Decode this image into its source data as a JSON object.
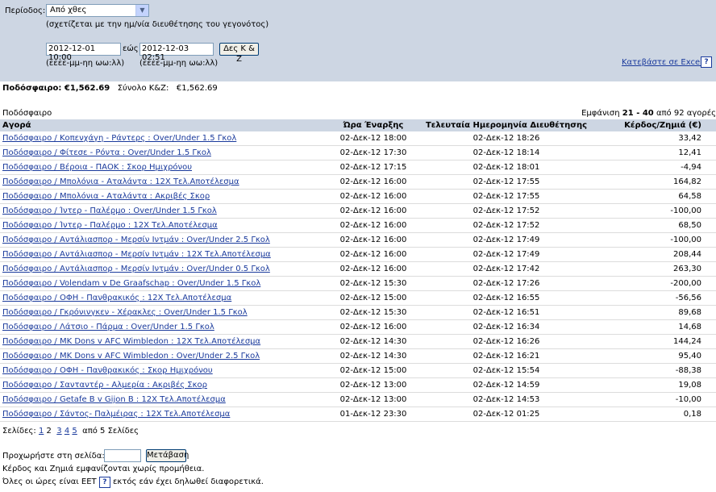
{
  "filter": {
    "period_label": "Περίοδος:",
    "period_value": "Από χθες",
    "period_note": "(σχετίζεται με την ημ/νία διευθέτησης του γεγονότος)",
    "date_from": "2012-12-01 10:00",
    "to_label": "εώς",
    "date_to": "2012-12-03 02:51",
    "show_button": "Δες Κ & Ζ",
    "format_hint": "(εεεε-μμ-ηη ωω:λλ)",
    "download_label": "Κατεβάστε σε Excel",
    "help_glyph": "?"
  },
  "summary": {
    "sport_total_label": "Ποδόσφαιρο: €1,562.69",
    "total_label": "Σύνολο Κ&Ζ:",
    "total_value": "€1,562.69"
  },
  "table_caption": "Ποδόσφαιρο",
  "pager_info": {
    "prefix": "Εμφάνιση",
    "range": "21 - 40",
    "suffix": "από 92 αγορές"
  },
  "columns": [
    "Αγορά",
    "Ώρα Έναρξης",
    "Τελευταία Ημερομηνία Διευθέτησης",
    "Κέρδος/Ζημιά (€)"
  ],
  "rows": [
    {
      "market": "Ποδόσφαιρο / Κοπενχάγη - Ράντερς : Over/Under 1.5 Γκολ",
      "start": "02-Δεκ-12 18:00",
      "settled": "02-Δεκ-12 18:26",
      "pl": "33,42"
    },
    {
      "market": "Ποδόσφαιρο / Φίτεσε - Ρόντα : Over/Under 1.5 Γκολ",
      "start": "02-Δεκ-12 17:30",
      "settled": "02-Δεκ-12 18:14",
      "pl": "12,41"
    },
    {
      "market": "Ποδόσφαιρο / Βέροια - ΠΑΟΚ : Σκορ Ημιχρόνου",
      "start": "02-Δεκ-12 17:15",
      "settled": "02-Δεκ-12 18:01",
      "pl": "-4,94"
    },
    {
      "market": "Ποδόσφαιρο / Μπολόνια - Αταλάντα : 12X Τελ.Αποτέλεσμα",
      "start": "02-Δεκ-12 16:00",
      "settled": "02-Δεκ-12 17:55",
      "pl": "164,82"
    },
    {
      "market": "Ποδόσφαιρο / Μπολόνια - Αταλάντα : Ακριβές Σκορ",
      "start": "02-Δεκ-12 16:00",
      "settled": "02-Δεκ-12 17:55",
      "pl": "64,58"
    },
    {
      "market": "Ποδόσφαιρο / Ίντερ - Παλέρμο : Over/Under 1.5 Γκολ",
      "start": "02-Δεκ-12 16:00",
      "settled": "02-Δεκ-12 17:52",
      "pl": "-100,00"
    },
    {
      "market": "Ποδόσφαιρο / Ίντερ - Παλέρμο : 12X Τελ.Αποτέλεσμα",
      "start": "02-Δεκ-12 16:00",
      "settled": "02-Δεκ-12 17:52",
      "pl": "68,50"
    },
    {
      "market": "Ποδόσφαιρο / Αντάλιασπορ - Μερσίν Ιντμάν : Over/Under 2.5 Γκολ",
      "start": "02-Δεκ-12 16:00",
      "settled": "02-Δεκ-12 17:49",
      "pl": "-100,00"
    },
    {
      "market": "Ποδόσφαιρο / Αντάλιασπορ - Μερσίν Ιντμάν : 12X Τελ.Αποτέλεσμα",
      "start": "02-Δεκ-12 16:00",
      "settled": "02-Δεκ-12 17:49",
      "pl": "208,44"
    },
    {
      "market": "Ποδόσφαιρο / Αντάλιασπορ - Μερσίν Ιντμάν : Over/Under 0.5 Γκολ",
      "start": "02-Δεκ-12 16:00",
      "settled": "02-Δεκ-12 17:42",
      "pl": "263,30"
    },
    {
      "market": "Ποδόσφαιρο / Volendam v De Graafschap : Over/Under 1.5 Γκολ",
      "start": "02-Δεκ-12 15:30",
      "settled": "02-Δεκ-12 17:26",
      "pl": "-200,00"
    },
    {
      "market": "Ποδόσφαιρο / ΟΦΗ - Πανθρακικός : 12X Τελ.Αποτέλεσμα",
      "start": "02-Δεκ-12 15:00",
      "settled": "02-Δεκ-12 16:55",
      "pl": "-56,56"
    },
    {
      "market": "Ποδόσφαιρο / Γκρόνινγκεν - Χέρακλες : Over/Under 1.5 Γκολ",
      "start": "02-Δεκ-12 15:30",
      "settled": "02-Δεκ-12 16:51",
      "pl": "89,68"
    },
    {
      "market": "Ποδόσφαιρο / Λάτσιο - Πάρμα : Over/Under 1.5 Γκολ",
      "start": "02-Δεκ-12 16:00",
      "settled": "02-Δεκ-12 16:34",
      "pl": "14,68"
    },
    {
      "market": "Ποδόσφαιρο / MK Dons v AFC Wimbledon : 12X Τελ.Αποτέλεσμα",
      "start": "02-Δεκ-12 14:30",
      "settled": "02-Δεκ-12 16:26",
      "pl": "144,24"
    },
    {
      "market": "Ποδόσφαιρο / MK Dons v AFC Wimbledon : Over/Under 2.5 Γκολ",
      "start": "02-Δεκ-12 14:30",
      "settled": "02-Δεκ-12 16:21",
      "pl": "95,40"
    },
    {
      "market": "Ποδόσφαιρο / ΟΦΗ - Πανθρακικός : Σκορ Ημιχρόνου",
      "start": "02-Δεκ-12 15:00",
      "settled": "02-Δεκ-12 15:54",
      "pl": "-88,38"
    },
    {
      "market": "Ποδόσφαιρο / Σανταντέρ - Αλμερία : Ακριβές Σκορ",
      "start": "02-Δεκ-12 13:00",
      "settled": "02-Δεκ-12 14:59",
      "pl": "19,08"
    },
    {
      "market": "Ποδόσφαιρο / Getafe B v Gijon B : 12X Τελ.Αποτέλεσμα",
      "start": "02-Δεκ-12 13:00",
      "settled": "02-Δεκ-12 14:53",
      "pl": "-10,00"
    },
    {
      "market": "Ποδόσφαιρο / Σάντος- Παλμέιρας : 12X Τελ.Αποτέλεσμα",
      "start": "01-Δεκ-12 23:30",
      "settled": "02-Δεκ-12 01:25",
      "pl": "0,18"
    }
  ],
  "pagination": {
    "label": "Σελίδες:",
    "pages": [
      "1",
      "2",
      "3",
      "4",
      "5"
    ],
    "current": "2",
    "suffix": "από 5 Σελίδες"
  },
  "goto": {
    "label": "Προχωρήστε στη σελίδα:",
    "button": "Μετάβαση"
  },
  "notes": {
    "commission": "Κέρδος και Ζημιά εμφανίζονται χωρίς προμήθεια.",
    "tz_prefix": "Όλες οι ώρες είναι EET",
    "tz_suffix": "εκτός εάν έχει δηλωθεί διαφορετικά."
  }
}
